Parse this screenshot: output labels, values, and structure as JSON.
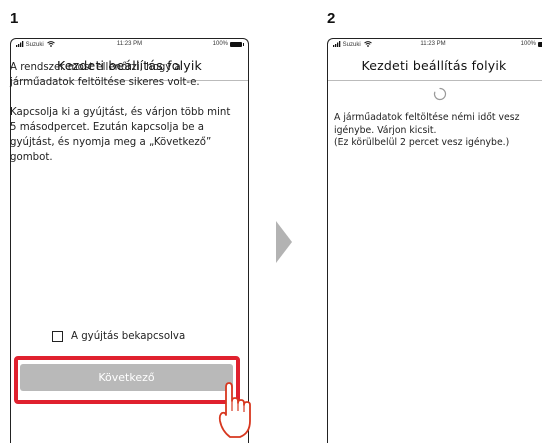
{
  "steps": [
    "1",
    "2"
  ],
  "status_bar": {
    "carrier": "Suzuki",
    "time": "11:23 PM",
    "battery": "100%"
  },
  "screen1": {
    "title": "Kezdeti beállítás folyik",
    "paragraph1": "A rendszer most ellenőrzi, hogy a járműadatok feltöltése sikeres volt-e.",
    "paragraph2": "Kapcsolja ki a gyújtást, és várjon több mint 5 másodpercet. Ezután kapcsolja be a gyújtást, és nyomja meg a „Következő” gombot.",
    "checkbox_label": "A gyújtás bekapcsolva",
    "checkbox_checked": false,
    "next_button": "Következő"
  },
  "screen2": {
    "title": "Kezdeti beállítás folyik",
    "message": "A járműadatok feltöltése némi időt vesz igénybe. Várjon kicsit.\n(Ez körülbelül 2 percet vesz igénybe.)"
  },
  "colors": {
    "highlight": "#e0212e",
    "button_disabled": "#b9b9b9"
  },
  "icons": [
    "signal-icon",
    "wifi-icon",
    "battery-icon",
    "spinner-icon",
    "hand-pointer-icon",
    "next-arrow-icon"
  ]
}
